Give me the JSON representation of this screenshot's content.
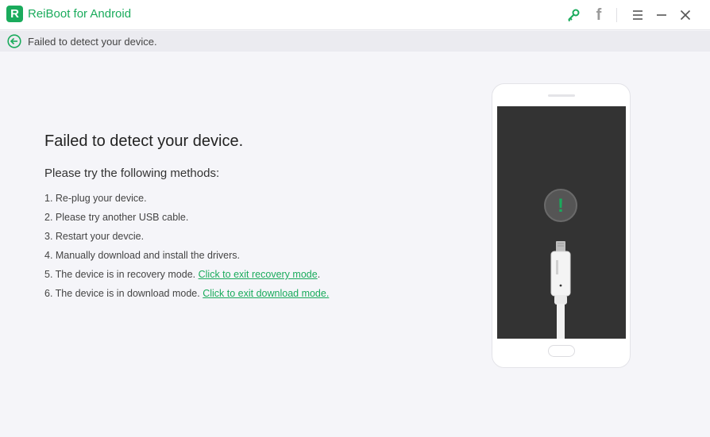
{
  "titlebar": {
    "logo_letter": "R",
    "app_title": "ReiBoot for Android",
    "icons": [
      "key-icon",
      "facebook-icon",
      "menu-icon",
      "minimize-icon",
      "close-icon"
    ],
    "facebook_glyph": "f"
  },
  "subbar": {
    "back_icon": "back-arrow-icon",
    "text": "Failed to detect your device."
  },
  "main": {
    "headline": "Failed to detect your device.",
    "methods_title": "Please try the following methods:",
    "methods": [
      {
        "text": "1. Re-plug your device.",
        "link": ""
      },
      {
        "text": "2. Please try another USB cable.",
        "link": ""
      },
      {
        "text": "3. Restart your devcie.",
        "link": ""
      },
      {
        "text": "4. Manually download and install the drivers.",
        "link": ""
      },
      {
        "text": "5. The device is in recovery mode. ",
        "link": "Click to exit recovery mode",
        "suffix": "."
      },
      {
        "text": "6. The device is in download mode. ",
        "link": "Click to exit download mode.",
        "suffix": ""
      }
    ]
  },
  "illustration": {
    "alert_glyph": "!",
    "colors": {
      "accent": "#1aab5c",
      "screen": "#333333",
      "badge": "#555555"
    }
  }
}
